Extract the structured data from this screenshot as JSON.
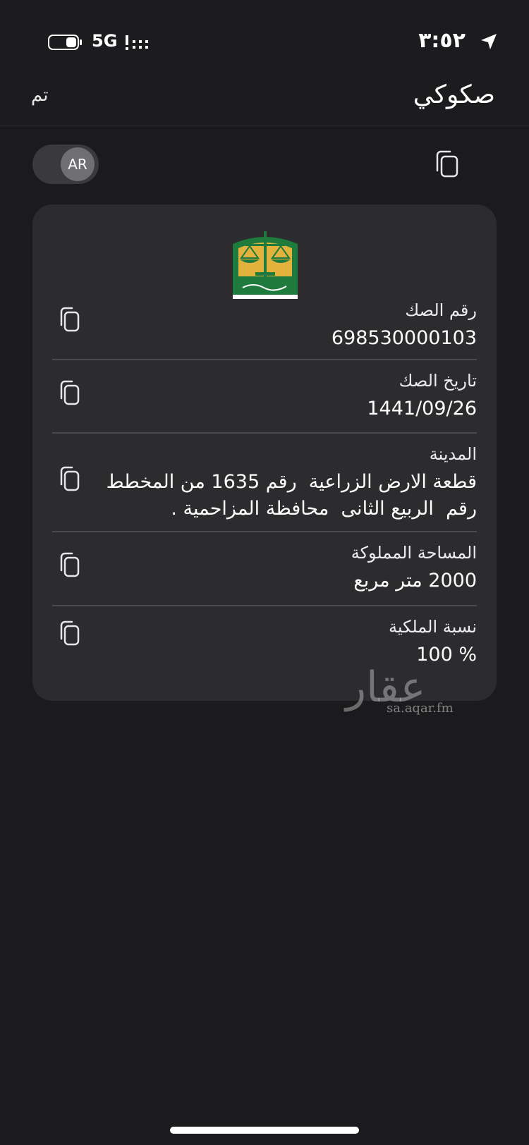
{
  "status_bar": {
    "time": "٣:٥٢",
    "network": "5G"
  },
  "nav": {
    "title": "صكوكي",
    "done_label": "تم"
  },
  "toggle": {
    "language_label": "AR"
  },
  "deed": {
    "fields": [
      {
        "label": "رقم الصك",
        "value": "698530000103"
      },
      {
        "label": "تاريخ الصك",
        "value": "1441/09/26"
      },
      {
        "label": "المدينة",
        "value_line1": "قطعة الارض الزراعية  رقم 1635 من المخطط",
        "value_line2": "رقم  الربيع الثانى  محافظة المزاحمية ."
      },
      {
        "label": "المساحة المملوكة",
        "value": "2000 متر مربع"
      },
      {
        "label": "نسبة الملكية",
        "value": "100 %"
      }
    ]
  },
  "watermark": {
    "brand": "عقار",
    "url": "sa.aqar.fm"
  },
  "icons": {
    "copy": "copy-icon",
    "location": "location-arrow-icon",
    "battery": "battery-icon",
    "signal": "signal-icon",
    "logo": "ministry-of-justice-logo"
  },
  "colors": {
    "background": "#1c1c1e",
    "card": "#2c2c2e",
    "logo_green": "#1f7a3d",
    "logo_gold": "#e3b23c"
  }
}
